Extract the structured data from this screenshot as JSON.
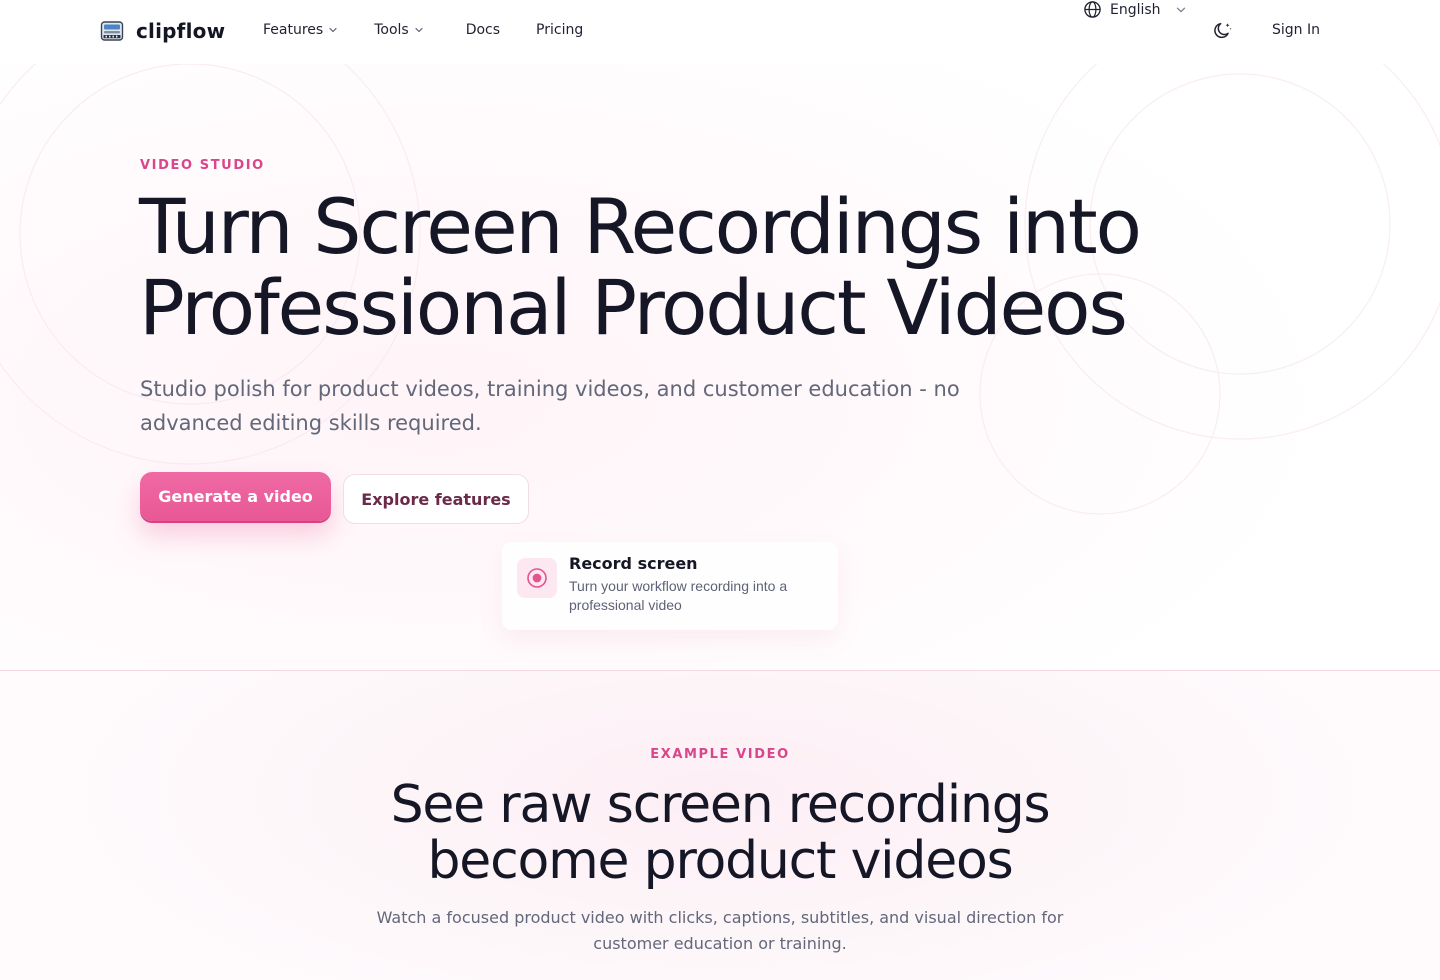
{
  "nav": {
    "brand": "clipflow",
    "links": [
      {
        "label": "Features",
        "has_dropdown": true
      },
      {
        "label": "Tools",
        "has_dropdown": true
      },
      {
        "label": "Docs",
        "has_dropdown": false
      },
      {
        "label": "Pricing",
        "has_dropdown": false
      }
    ],
    "language": "English",
    "theme_icon": "moon-icon",
    "sign_in": "Sign In"
  },
  "hero": {
    "eyebrow": "VIDEO STUDIO",
    "title_line1": "Turn Screen Recordings into",
    "title_line2": "Professional Product Videos",
    "subtitle": "Studio polish for product videos, training videos, and customer education - no advanced editing skills required.",
    "primary_cta": "Generate a video",
    "secondary_cta": "Explore features",
    "card": {
      "icon": "record-icon",
      "title": "Record screen",
      "description": "Turn your workflow recording into a professional video"
    }
  },
  "example": {
    "eyebrow": "EXAMPLE VIDEO",
    "title_line1": "See raw screen recordings",
    "title_line2": "become product videos",
    "subtitle": "Watch a focused product video with clicks, captions, subtitles, and visual direction for customer education or training."
  },
  "colors": {
    "accent": "#e85895",
    "eyebrow": "#d9468a",
    "text": "#151726",
    "muted": "#62677a"
  }
}
